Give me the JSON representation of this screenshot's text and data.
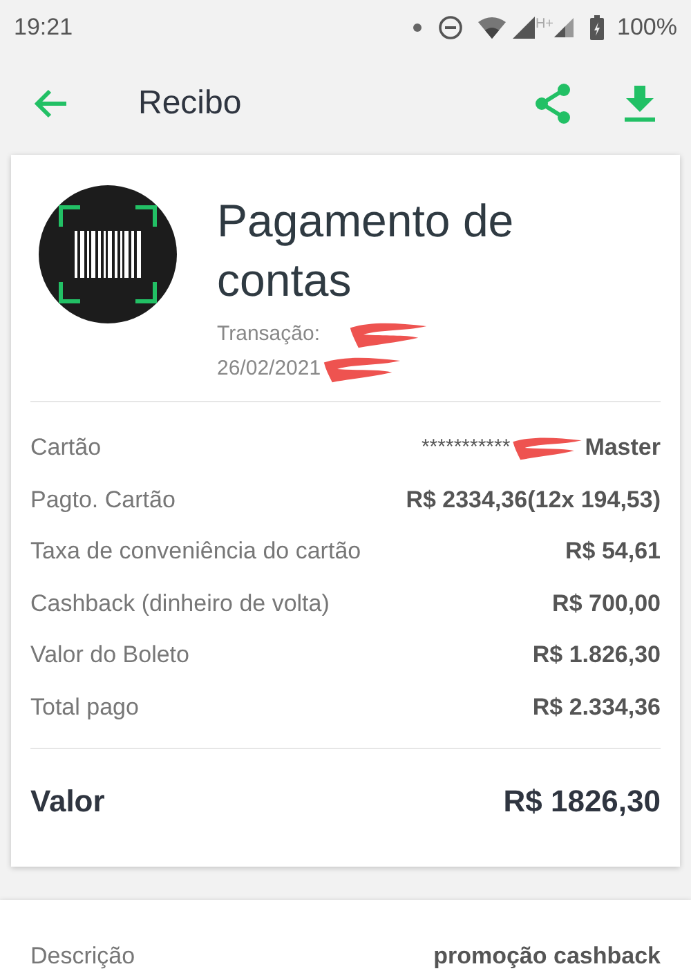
{
  "status_bar": {
    "time": "19:21",
    "battery": "100%",
    "network": "H+"
  },
  "toolbar": {
    "title": "Recibo"
  },
  "receipt": {
    "title": "Pagamento de contas",
    "transaction_label": "Transação:",
    "date": "26/02/2021",
    "rows": [
      {
        "label": "Cartão",
        "value": "***********",
        "value_end": "Master",
        "kind": "card"
      },
      {
        "label": "Pagto. Cartão",
        "value": "R$ 2334,36(12x 194,53)",
        "kind": "plain"
      },
      {
        "label": "Taxa de conveniência do cartão",
        "value": "R$ 54,61",
        "kind": "plain"
      },
      {
        "label": "Cashback (dinheiro de volta)",
        "value": "R$ 700,00",
        "kind": "plain"
      },
      {
        "label": "Valor do Boleto",
        "value": "R$ 1.826,30",
        "kind": "plain"
      },
      {
        "label": "Total pago",
        "value": "R$ 2.334,36",
        "kind": "plain"
      }
    ],
    "total_label": "Valor",
    "total_value": "R$ 1826,30"
  },
  "details": {
    "label": "Descrição",
    "value": "promoção cashback"
  }
}
